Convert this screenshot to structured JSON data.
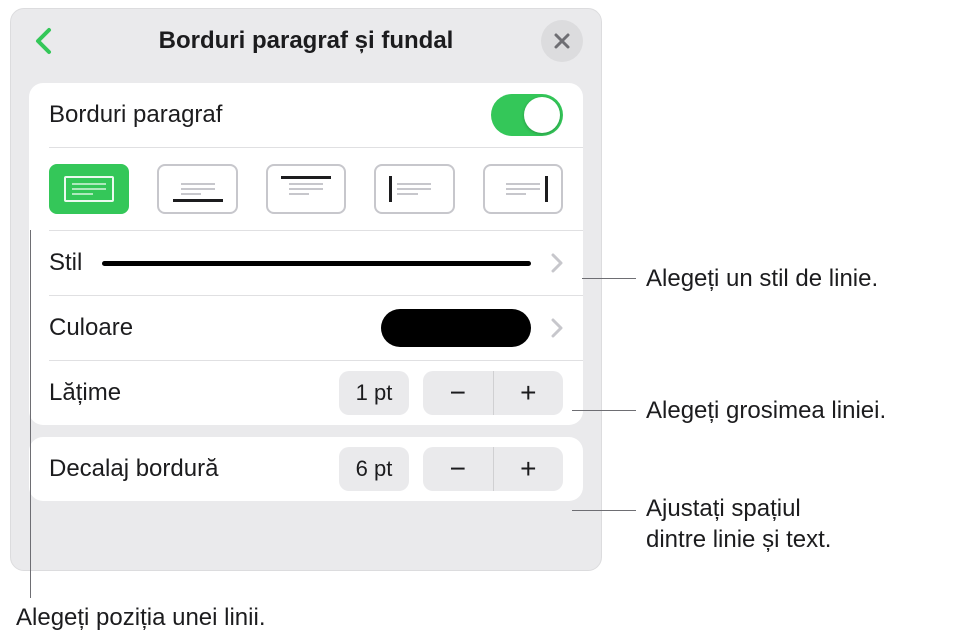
{
  "header": {
    "title": "Borduri paragraf și fundal"
  },
  "section1": {
    "toggle_label": "Borduri paragraf",
    "toggle_on": true,
    "positions": [
      {
        "name": "border-all",
        "selected": true
      },
      {
        "name": "border-bottom",
        "selected": false
      },
      {
        "name": "border-top",
        "selected": false
      },
      {
        "name": "border-left",
        "selected": false
      },
      {
        "name": "border-right",
        "selected": false
      }
    ],
    "style_label": "Stil",
    "color_label": "Culoare",
    "color_value": "#000000",
    "width_label": "Lățime",
    "width_value": "1 pt"
  },
  "section2": {
    "offset_label": "Decalaj bordură",
    "offset_value": "6 pt"
  },
  "callouts": {
    "style": "Alegeți un stil de linie.",
    "width": "Alegeți grosimea liniei.",
    "offset_line1": "Ajustați spațiul",
    "offset_line2": "dintre linie și text.",
    "position": "Alegeți poziția unei linii."
  },
  "icons": {
    "minus": "−",
    "plus": "+"
  }
}
